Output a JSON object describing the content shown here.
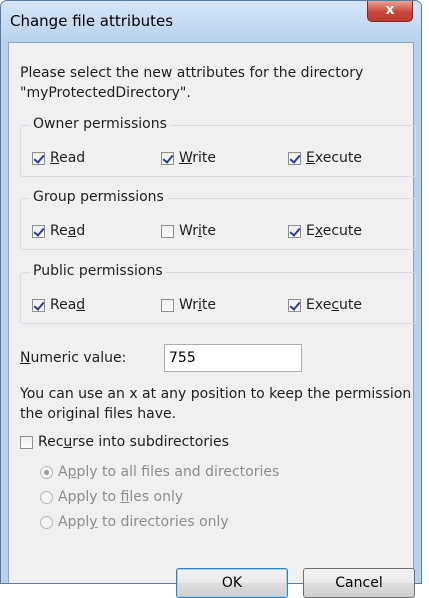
{
  "window": {
    "title": "Change file attributes",
    "close_label": "x"
  },
  "prompt": {
    "line1": "Please select the new attributes for the directory",
    "line2": "\"myProtectedDirectory\"."
  },
  "groups": {
    "owner": {
      "label": "Owner permissions",
      "read": {
        "pre": "",
        "key": "R",
        "post": "ead",
        "checked": true
      },
      "write": {
        "pre": "",
        "key": "W",
        "post": "rite",
        "checked": true
      },
      "execute": {
        "pre": "",
        "key": "E",
        "post": "xecute",
        "checked": true
      }
    },
    "group": {
      "label": "Group permissions",
      "read": {
        "pre": "Re",
        "key": "a",
        "post": "d",
        "checked": true
      },
      "write": {
        "pre": "Wr",
        "key": "i",
        "post": "te",
        "checked": false
      },
      "execute": {
        "pre": "E",
        "key": "x",
        "post": "ecute",
        "checked": true
      }
    },
    "public": {
      "label": "Public permissions",
      "read": {
        "pre": "Rea",
        "key": "d",
        "post": "",
        "checked": true
      },
      "write": {
        "pre": "Wr",
        "key": "i",
        "post": "te",
        "checked": false
      },
      "execute": {
        "pre": "Exe",
        "key": "c",
        "post": "ute",
        "checked": true
      }
    }
  },
  "numeric": {
    "label_key": "N",
    "label_rest": "umeric value:",
    "value": "755"
  },
  "hint": {
    "line1": "You can use an x at any position to keep the permission",
    "line2": "the original files have."
  },
  "recurse": {
    "pre": "Rec",
    "key": "u",
    "post": "rse into subdirectories",
    "checked": false
  },
  "apply_options": {
    "all": {
      "pre": "A",
      "key": "p",
      "post": "ply to all files and directories",
      "selected": true
    },
    "files": {
      "pre": "Apply to ",
      "key": "f",
      "post": "iles only",
      "selected": false
    },
    "dirs": {
      "pre": "Appl",
      "key": "y",
      "post": " to directories only",
      "selected": false
    }
  },
  "buttons": {
    "ok": "OK",
    "cancel": "Cancel"
  }
}
